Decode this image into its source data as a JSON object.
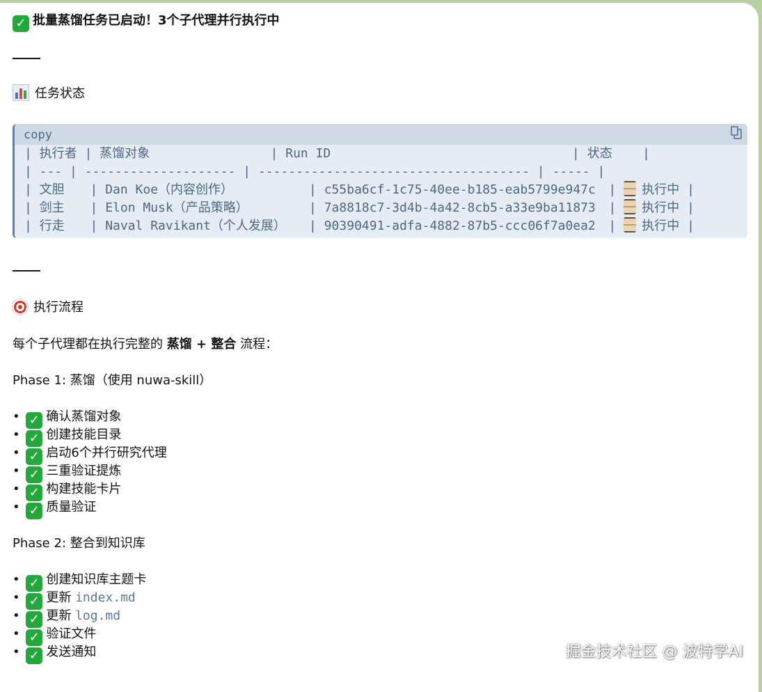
{
  "header": {
    "title": "批量蒸馏任务已启动！3个子代理并行执行中"
  },
  "status_section": {
    "heading": "任务状态",
    "code_block_label": "copy",
    "table": {
      "header_row": "| 执行者 | 蒸馏对象                | Run ID                                | 状态    |",
      "separator_row": "| --- | -------------------- | ------------------------------------ | ----- |",
      "rows": [
        {
          "executor": "文胆",
          "target": "Dan Koe（内容创作）",
          "run_id": "c55ba6cf-1c75-40ee-b185-eab5799e947c",
          "status": "执行中"
        },
        {
          "executor": "剑主",
          "target": "Elon Musk（产品策略）",
          "run_id": "7a8818c7-3d4b-4a42-8cb5-a33e9ba11873",
          "status": "执行中"
        },
        {
          "executor": "行走",
          "target": "Naval Ravikant（个人发展）",
          "run_id": "90390491-adfa-4882-87b5-ccc06f7a0ea2",
          "status": "执行中"
        }
      ]
    }
  },
  "flow_section": {
    "heading": "执行流程",
    "intro_prefix": "每个子代理都在执行完整的 ",
    "intro_bold": "蒸馏 + 整合",
    "intro_suffix": " 流程：",
    "phase1_title": "Phase 1: 蒸馏（使用 nuwa-skill）",
    "phase1_items": [
      "确认蒸馏对象",
      "创建技能目录",
      "启动6个并行研究代理",
      "三重验证提炼",
      "构建技能卡片",
      "质量验证"
    ],
    "phase2_title": "Phase 2: 整合到知识库",
    "phase2_items": [
      {
        "prefix": "创建知识库主题卡",
        "code": ""
      },
      {
        "prefix": "更新 ",
        "code": "index.md"
      },
      {
        "prefix": "更新 ",
        "code": "log.md"
      },
      {
        "prefix": "验证文件",
        "code": ""
      },
      {
        "prefix": "发送通知",
        "code": ""
      }
    ]
  },
  "icons": {
    "check": "check-mark-button-icon",
    "status": "bar-chart-icon",
    "flow": "direct-hit-target-icon",
    "running": "hourglass-icon",
    "copy": "copy-icon"
  },
  "colors": {
    "background_green": "#b8cf9f",
    "check_green": "#25a83b",
    "code_text": "#4d6683",
    "code_bg": "#e6ecf3"
  },
  "watermark": "掘金技术社区 @ 波特学AI"
}
